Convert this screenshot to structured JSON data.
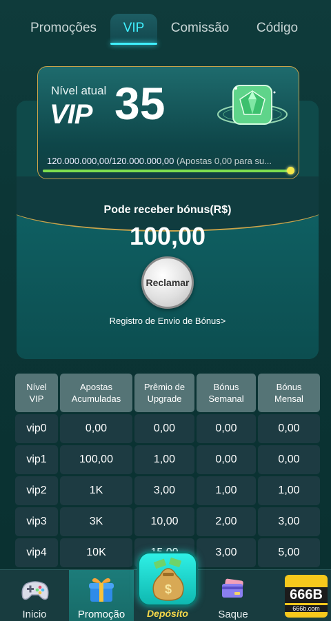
{
  "tabs": [
    {
      "label": "Promoções",
      "active": false
    },
    {
      "label": "VIP",
      "active": true
    },
    {
      "label": "Comissão",
      "active": false
    },
    {
      "label": "Código",
      "active": false
    }
  ],
  "vip_card": {
    "level_label": "Nível atual",
    "vip_word": "VIP",
    "level": "35",
    "gem_icon": "green-diamond-gem-icon",
    "progress_value": "120.000.000,00/120.000.000,00",
    "progress_note": "(Apostas 0,00 para su...",
    "progress_fraction": 1.0
  },
  "bonus": {
    "title": "Pode receber bónus(R$)",
    "amount": "100,00",
    "claim_label": "Reclamar",
    "history_link": "Registro de Envio de Bónus>"
  },
  "table": {
    "headers": [
      "Nível VIP",
      "Apostas Acumuladas",
      "Prêmio de Upgrade",
      "Bónus Semanal",
      "Bónus Mensal"
    ],
    "rows": [
      [
        "vip0",
        "0,00",
        "0,00",
        "0,00",
        "0,00"
      ],
      [
        "vip1",
        "100,00",
        "1,00",
        "0,00",
        "0,00"
      ],
      [
        "vip2",
        "1K",
        "3,00",
        "1,00",
        "1,00"
      ],
      [
        "vip3",
        "3K",
        "10,00",
        "2,00",
        "3,00"
      ],
      [
        "vip4",
        "10K",
        "15,00",
        "3,00",
        "5,00"
      ]
    ]
  },
  "nav": {
    "items": [
      {
        "label": "Inicio",
        "icon": "gamepad-icon",
        "active": false
      },
      {
        "label": "Promoção",
        "icon": "gift-box-icon",
        "active": true
      },
      {
        "label": "Depósito",
        "icon": "money-bag-icon",
        "active": false
      },
      {
        "label": "Saque",
        "icon": "wallet-cards-icon",
        "active": false
      }
    ],
    "logo": {
      "main": "666B",
      "sub": "666b.com"
    }
  },
  "colors": {
    "accent": "#3ff0ff",
    "card_border": "#c9a34a",
    "progress": "#7ee04f",
    "deposit": "#f6d84a"
  }
}
